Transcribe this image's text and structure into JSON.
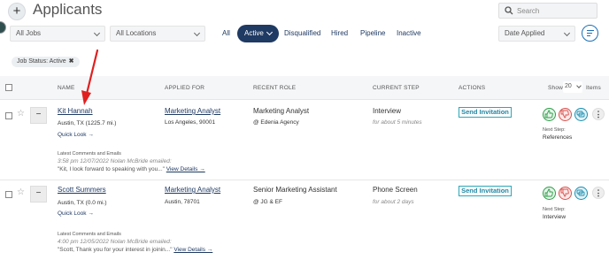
{
  "header": {
    "add_label": "+",
    "title": "Applicants",
    "search_placeholder": "Search"
  },
  "filters": {
    "jobs": "All Jobs",
    "locations": "All Locations",
    "tabs": [
      "All",
      "Active",
      "Disqualified",
      "Hired",
      "Pipeline",
      "Inactive"
    ],
    "active_tab": "Active",
    "sort": "Date Applied"
  },
  "chip": {
    "label": "Job Status: Active",
    "remove": "✖"
  },
  "columns": {
    "name": "NAME",
    "applied_for": "APPLIED FOR",
    "recent_role": "RECENT ROLE",
    "current_step": "CURRENT STEP",
    "actions": "ACTIONS",
    "show": "Show",
    "page_size": "20",
    "items": "Items"
  },
  "applicants": [
    {
      "name": "Kit Hannah",
      "location": "Austin, TX (1225.7 mi.)",
      "quick_look": "Quick Look →",
      "job": "Marketing Analyst",
      "job_location": "Los Angeles, 90001",
      "role": "Marketing Analyst",
      "company": "@ Edenia Agency",
      "step": "Interview",
      "step_duration": "for about 5 minutes",
      "action_label": "Send Invitation",
      "next_step_label": "Next Step:",
      "next_step": "References",
      "comments_label": "Latest Comments and Emails",
      "comment_meta": "3:58 pm 12/07/2022 Nolan McBride emailed:",
      "comment_text": "\"Kit, I look forward to speaking with you...\"",
      "view_details": "View Details →"
    },
    {
      "name": "Scott Summers",
      "location": "Austin, TX (0.0 mi.)",
      "quick_look": "Quick Look →",
      "job": "Marketing Analyst",
      "job_location": "Austin, 78701",
      "role": "Senior Marketing Assistant",
      "company": "@ JG & EF",
      "step": "Phone Screen",
      "step_duration": "for about 2 days",
      "action_label": "Send Invitation",
      "next_step_label": "Next Step:",
      "next_step": "Interview",
      "comments_label": "Latest Comments and Emails",
      "comment_meta": "4:00 pm 12/05/2022 Nolan McBride emailed:",
      "comment_text": "\"Scott, Thank you for your interest in joinin...\"",
      "view_details": "View Details →"
    }
  ],
  "icons": {
    "search": "search-icon",
    "sort": "sort-options-icon",
    "star": "star-icon",
    "thumbs_up": "thumbs-up-icon",
    "thumbs_down": "thumbs-down-icon",
    "message": "message-icon",
    "more": "more-vertical-icon",
    "arrow": "red-arrow-annotation"
  },
  "colors": {
    "primary": "#1f3a63",
    "teal": "#2aa7b8",
    "green": "#2e9e48",
    "red": "#d9534f",
    "arrow": "#e02020"
  }
}
